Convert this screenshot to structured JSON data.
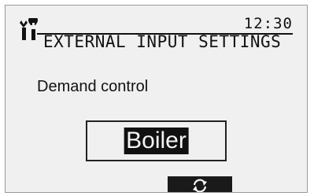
{
  "header": {
    "time": "12:30",
    "title": "EXTERNAL INPUT SETTINGS",
    "icon": "tool-icon"
  },
  "setting": {
    "label": "Demand control",
    "value": "Boiler"
  },
  "softkey": {
    "icon": "cycle-icon"
  },
  "colors": {
    "screen_bg": "#f0f0f0",
    "text": "#111111",
    "highlight_bg": "#111111",
    "highlight_text": "#f5f5f5"
  }
}
